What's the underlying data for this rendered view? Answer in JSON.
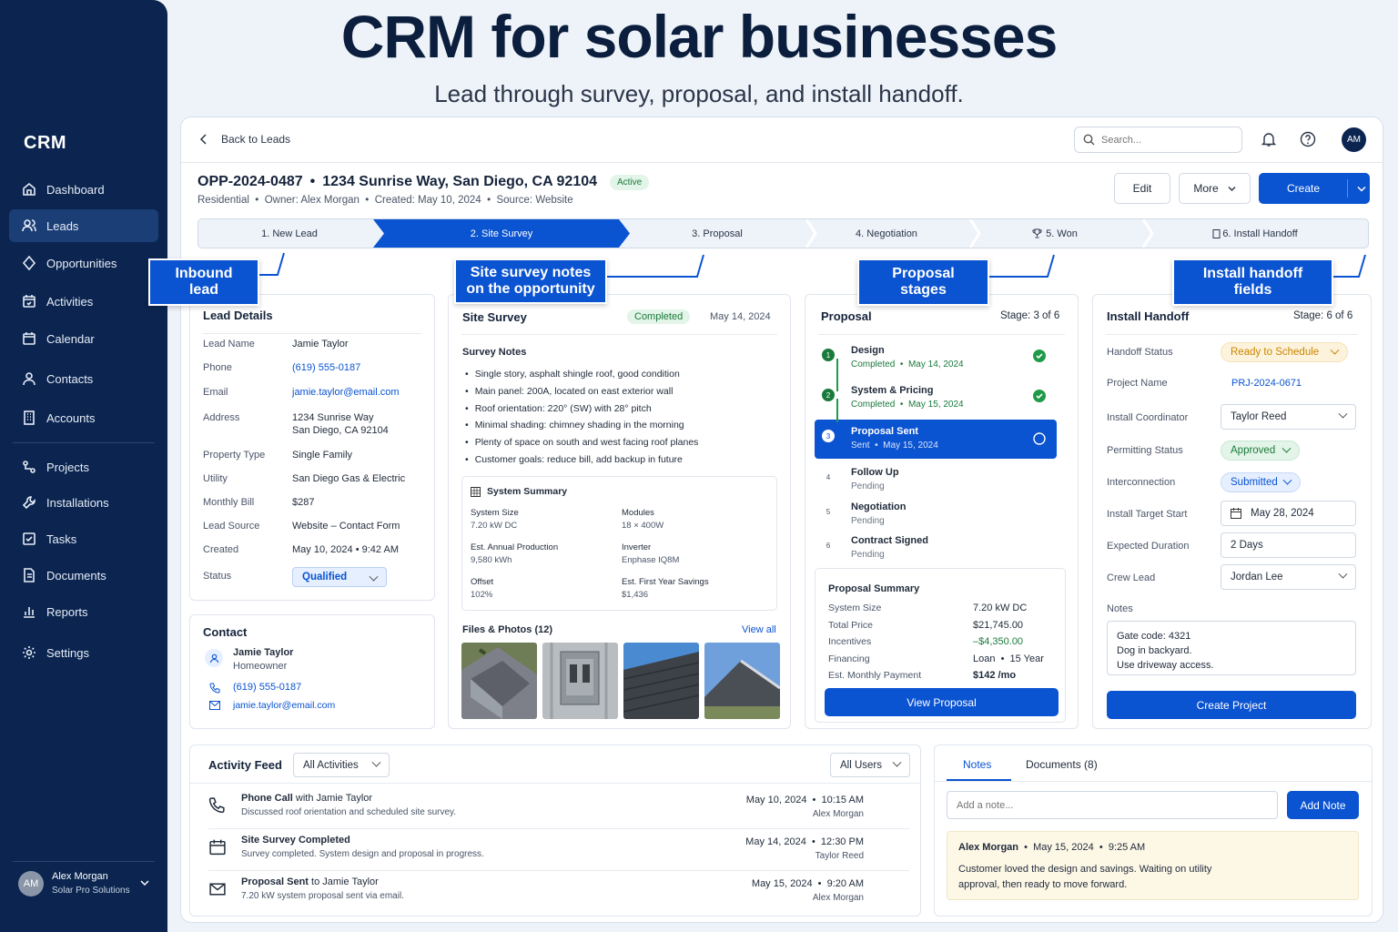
{
  "hero": {
    "title": "CRM for solar businesses",
    "subtitle": "Lead through survey, proposal, and install handoff."
  },
  "sidebar": {
    "brand": "CRM",
    "items": [
      {
        "label": "Dashboard",
        "icon": "home-icon"
      },
      {
        "label": "Leads",
        "icon": "users-icon"
      },
      {
        "label": "Opportunities",
        "icon": "diamond-icon"
      },
      {
        "label": "Activities",
        "icon": "calendar-check-icon"
      },
      {
        "label": "Calendar",
        "icon": "calendar-icon"
      },
      {
        "label": "Contacts",
        "icon": "user-icon"
      },
      {
        "label": "Accounts",
        "icon": "building-icon"
      },
      {
        "label": "Projects",
        "icon": "project-icon"
      },
      {
        "label": "Installations",
        "icon": "wrench-icon"
      },
      {
        "label": "Tasks",
        "icon": "checkbox-icon"
      },
      {
        "label": "Documents",
        "icon": "document-icon"
      },
      {
        "label": "Reports",
        "icon": "bar-chart-icon"
      },
      {
        "label": "Settings",
        "icon": "gear-icon"
      }
    ],
    "user": {
      "initials": "AM",
      "name": "Alex Morgan",
      "company": "Solar Pro Solutions"
    }
  },
  "topbar": {
    "back": "Back to Leads",
    "search_placeholder": "Search...",
    "avatar": "AM"
  },
  "opportunity": {
    "id": "OPP-2024-0487",
    "sep": "•",
    "address": "1234 Sunrise Way, San Diego, CA 92104",
    "status": "Active",
    "meta": "Residential  •  Owner: Alex Morgan  •  Created: May 10, 2024  •  Source: Website",
    "buttons": {
      "edit": "Edit",
      "more": "More",
      "create": "Create"
    }
  },
  "stages": [
    "1. New Lead",
    "2. Site Survey",
    "3. Proposal",
    "4. Negotiation",
    "5. Won",
    "6. Install Handoff"
  ],
  "callouts": {
    "inbound": "Inbound lead",
    "survey": "Site survey notes on the opportunity",
    "proposal": "Proposal stages",
    "handoff": "Install handoff fields"
  },
  "lead": {
    "title": "Lead Details",
    "rows": [
      {
        "label": "Lead Name",
        "value": "Jamie Taylor"
      },
      {
        "label": "Phone",
        "value": "(619) 555-0187"
      },
      {
        "label": "Email",
        "value": "jamie.taylor@email.com"
      },
      {
        "label": "Address",
        "value": "1234 Sunrise Way",
        "value2": "San Diego, CA 92104"
      },
      {
        "label": "Property Type",
        "value": "Single Family"
      },
      {
        "label": "Utility",
        "value": "San Diego Gas & Electric"
      },
      {
        "label": "Monthly Bill",
        "value": "$287"
      },
      {
        "label": "Lead Source",
        "value": "Website – Contact Form"
      },
      {
        "label": "Created",
        "value": "May 10, 2024  •  9:42 AM"
      },
      {
        "label": "Status",
        "value": "Qualified"
      }
    ]
  },
  "contact": {
    "title": "Contact",
    "name": "Jamie Taylor",
    "role": "Homeowner",
    "phone": "(619) 555-0187",
    "email": "jamie.taylor@email.com"
  },
  "survey": {
    "title": "Site Survey",
    "status": "Completed",
    "date": "May 14, 2024",
    "notes_title": "Survey Notes",
    "notes": [
      "Single story, asphalt shingle roof, good condition",
      "Main panel: 200A, located on east exterior wall",
      "Roof orientation: 220° (SW) with 28° pitch",
      "Minimal shading: chimney shading in the morning",
      "Plenty of space on south and west facing roof planes",
      "Customer goals: reduce bill, add backup in future"
    ],
    "system_title": "System Summary",
    "system": [
      {
        "label": "System Size",
        "value": "7.20 kW DC"
      },
      {
        "label": "Modules",
        "value": "18 × 400W"
      },
      {
        "label": "Est. Annual Production",
        "value": "9,580 kWh"
      },
      {
        "label": "Inverter",
        "value": "Enphase IQ8M"
      },
      {
        "label": "Offset",
        "value": "102%"
      },
      {
        "label": "Est. First Year Savings",
        "value": "$1,436"
      }
    ],
    "files_title": "Files & Photos (12)",
    "view_all": "View all"
  },
  "proposal": {
    "title": "Proposal",
    "stage": "Stage: 3 of 6",
    "steps": [
      {
        "n": "1",
        "title": "Design",
        "sub": "Completed  •  May 14, 2024"
      },
      {
        "n": "2",
        "title": "System & Pricing",
        "sub": "Completed  •  May 15, 2024"
      },
      {
        "n": "3",
        "title": "Proposal Sent",
        "sub": "Sent  •  May 15, 2024"
      },
      {
        "n": "4",
        "title": "Follow Up",
        "sub": "Pending"
      },
      {
        "n": "5",
        "title": "Negotiation",
        "sub": "Pending"
      },
      {
        "n": "6",
        "title": "Contract Signed",
        "sub": "Pending"
      }
    ],
    "summary_title": "Proposal Summary",
    "summary": [
      {
        "label": "System Size",
        "value": "7.20 kW DC"
      },
      {
        "label": "Total Price",
        "value": "$21,745.00"
      },
      {
        "label": "Incentives",
        "value": "–$4,350.00"
      },
      {
        "label": "Financing",
        "value": "Loan  •  15 Year"
      },
      {
        "label": "Est. Monthly Payment",
        "value": "$142 /mo"
      }
    ],
    "button": "View Proposal"
  },
  "handoff": {
    "title": "Install Handoff",
    "stage": "Stage: 6 of 6",
    "rows": [
      {
        "label": "Handoff Status",
        "value": "Ready to Schedule"
      },
      {
        "label": "Project Name",
        "value": "PRJ-2024-0671"
      },
      {
        "label": "Install Coordinator",
        "value": "Taylor Reed"
      },
      {
        "label": "Permitting Status",
        "value": "Approved"
      },
      {
        "label": "Interconnection",
        "value": "Submitted"
      },
      {
        "label": "Install Target Start",
        "value": "May 28, 2024"
      },
      {
        "label": "Expected Duration",
        "value": "2 Days"
      },
      {
        "label": "Crew Lead",
        "value": "Jordan Lee"
      },
      {
        "label": "Notes",
        "value": ""
      }
    ],
    "notes": [
      "Gate code: 4321",
      "Dog in backyard.",
      "Use driveway access."
    ],
    "button": "Create Project"
  },
  "feed": {
    "title": "Activity Feed",
    "filter1": "All Activities",
    "filter2": "All Users",
    "items": [
      {
        "bold": "Phone Call",
        "rest": " with Jamie Taylor",
        "desc": "Discussed roof orientation and scheduled site survey.",
        "date": "May 10, 2024  •  10:15 AM",
        "user": "Alex Morgan"
      },
      {
        "bold": "Site Survey Completed",
        "rest": "",
        "desc": "Survey completed. System design and proposal in progress.",
        "date": "May 14, 2024  •  12:30 PM",
        "user": "Taylor Reed"
      },
      {
        "bold": "Proposal Sent",
        "rest": " to Jamie Taylor",
        "desc": "7.20 kW system proposal sent via email.",
        "date": "May 15, 2024  •  9:20 AM",
        "user": "Alex Morgan"
      }
    ]
  },
  "notes_panel": {
    "tab_notes": "Notes",
    "tab_docs": "Documents (8)",
    "placeholder": "Add a note...",
    "add": "Add Note",
    "note_author": "Alex Morgan",
    "note_date": "  •  May 15, 2024  •  9:25 AM",
    "note_text": "Customer loved the design and savings. Waiting on utility approval, then ready to move forward."
  },
  "colors": {
    "accent": "#0a53d1",
    "sidebar": "#0b2550",
    "success": "#1a7a3b",
    "warning": "#c98500"
  }
}
